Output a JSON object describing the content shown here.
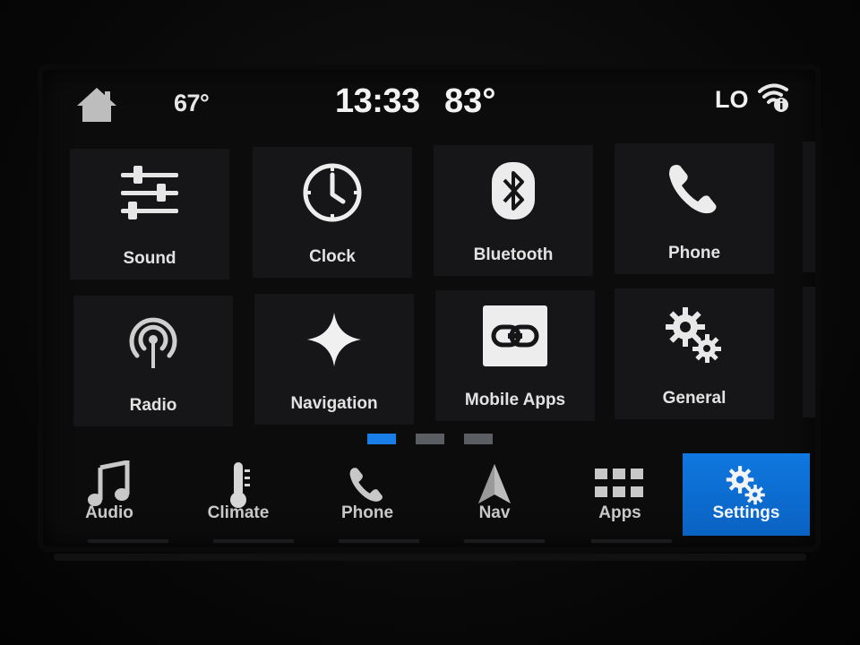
{
  "status_bar": {
    "outside_temp": "67°",
    "time": "13:33",
    "inside_temp": "83°",
    "fan_level": "LO",
    "home_icon": "home-icon",
    "wifi_icon": "wifi-info-icon"
  },
  "tiles": [
    {
      "label": "Sound",
      "icon": "equalizer-sliders-icon"
    },
    {
      "label": "Clock",
      "icon": "clock-icon"
    },
    {
      "label": "Bluetooth",
      "icon": "bluetooth-icon"
    },
    {
      "label": "Phone",
      "icon": "phone-handset-icon"
    },
    {
      "label": "Radio",
      "icon": "radio-antenna-icon"
    },
    {
      "label": "Navigation",
      "icon": "compass-star-icon"
    },
    {
      "label": "Mobile Apps",
      "icon": "link-icon"
    },
    {
      "label": "General",
      "icon": "gears-icon"
    }
  ],
  "pager": {
    "pages": 3,
    "active_index": 0,
    "active_color": "#1a7ee8"
  },
  "bottom_nav": [
    {
      "label": "Audio",
      "icon": "music-note-icon",
      "active": false
    },
    {
      "label": "Climate",
      "icon": "thermometer-icon",
      "active": false
    },
    {
      "label": "Phone",
      "icon": "phone-handset-icon",
      "active": false
    },
    {
      "label": "Nav",
      "icon": "navigation-arrow-icon",
      "active": false
    },
    {
      "label": "Apps",
      "icon": "apps-grid-icon",
      "active": false
    },
    {
      "label": "Settings",
      "icon": "gears-icon",
      "active": true
    }
  ],
  "colors": {
    "accent": "#0b6fd6",
    "tile_bg": "#161618",
    "text": "#e2e2e2"
  }
}
